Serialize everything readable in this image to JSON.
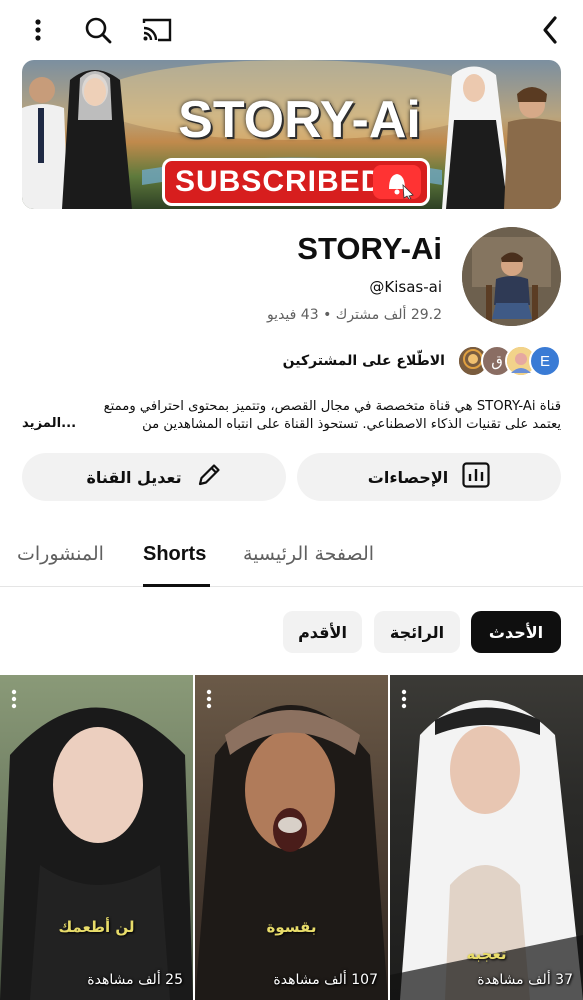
{
  "topbar": {
    "icons": [
      "more-vert-icon",
      "search-icon",
      "cast-icon",
      "back-chevron-icon"
    ]
  },
  "banner": {
    "title": "STORY-Ai",
    "button_label": "SUBSCRIBED"
  },
  "channel": {
    "name": "STORY-Ai",
    "handle": "@Kisas-ai",
    "subscribers": "29.2 ألف مشترك",
    "separator": "•",
    "videos": "43 فيديو",
    "subs_link": "الاطّلاع على المشتركين",
    "sub_avatar_letters": [
      "E",
      "ق"
    ],
    "description_line1": "قناة STORY-Ai هي قناة متخصصة في مجال القصص، وتتميز بمحتوى احترافي وممتع",
    "description_line2": "يعتمد على تقنيات الذكاء الاصطناعي. تستحوذ القناة على انتباه المشاهدين من",
    "more": "...المزيد"
  },
  "actions": {
    "stats_label": "الإحصاءات",
    "edit_label": "تعديل القناة"
  },
  "tabs": {
    "home": "الصفحة الرئيسية",
    "shorts": "Shorts",
    "posts": "المنشورات",
    "active": "Shorts"
  },
  "chips": {
    "latest": "الأحدث",
    "popular": "الرائجة",
    "oldest": "الأقدم",
    "selected": "الأحدث"
  },
  "shorts": [
    {
      "caption": "تعجبه",
      "views": "37 ألف مشاهدة"
    },
    {
      "caption": "بقسوة",
      "views": "107 ألف مشاهدة"
    },
    {
      "caption": "لن أطعمك",
      "views": "25 ألف مشاهدة"
    }
  ],
  "colors": {
    "banner_button": "#d71e1e",
    "chip_selected": "#0f0f0f",
    "caption": "#e8dc6a",
    "avatar_e": "#3a7bd5"
  }
}
